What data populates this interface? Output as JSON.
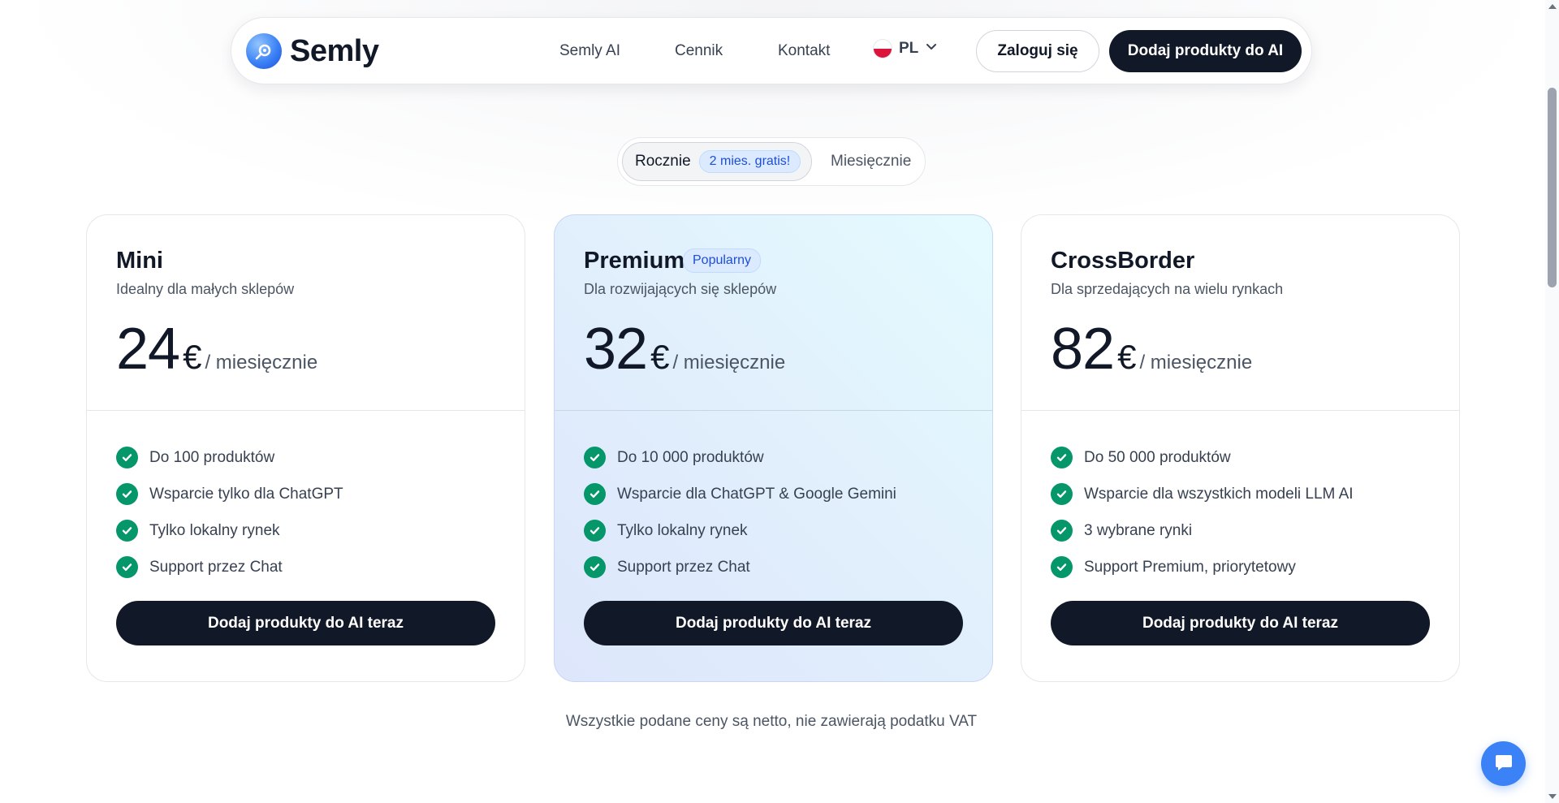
{
  "nav": {
    "brand": "Semly",
    "links": [
      "Semly AI",
      "Cennik",
      "Kontakt"
    ],
    "language": "PL",
    "login_label": "Zaloguj się",
    "cta_label": "Dodaj produkty do AI"
  },
  "billing": {
    "annual_label": "Rocznie",
    "annual_badge": "2 mies. gratis!",
    "monthly_label": "Miesięcznie",
    "selected": "annual"
  },
  "plans": [
    {
      "name": "Mini",
      "description": "Idealny dla małych sklepów",
      "price": "24",
      "currency": "€",
      "period": "/ miesięcznie",
      "features": [
        "Do 100 produktów",
        "Wsparcie tylko dla ChatGPT",
        "Tylko lokalny rynek",
        "Support przez Chat"
      ],
      "cta": "Dodaj produkty do AI teraz"
    },
    {
      "name": "Premium",
      "badge": "Popularny",
      "description": "Dla rozwijających się sklepów",
      "price": "32",
      "currency": "€",
      "period": "/ miesięcznie",
      "features": [
        "Do 10 000 produktów",
        "Wsparcie dla ChatGPT & Google Gemini",
        "Tylko lokalny rynek",
        "Support przez Chat"
      ],
      "cta": "Dodaj produkty do AI teraz"
    },
    {
      "name": "CrossBorder",
      "description": "Dla sprzedających na wielu rynkach",
      "price": "82",
      "currency": "€",
      "period": "/ miesięcznie",
      "features": [
        "Do 50 000 produktów",
        "Wsparcie dla wszystkich modeli LLM AI",
        "3 wybrane rynki",
        "Support Premium, priorytetowy"
      ],
      "cta": "Dodaj produkty do AI teraz"
    }
  ],
  "footer_note": "Wszystkie podane ceny są netto, nie zawierają podatku VAT",
  "icons": {
    "logo": "semly-logo-icon",
    "feature_check": "check-icon",
    "language_chevron": "chevron-down-icon",
    "chat": "chat-icon"
  },
  "colors": {
    "primary_dark": "#111827",
    "accent_blue": "#3b82f6",
    "badge_bg": "#dbeafe",
    "badge_text": "#1d4ed8",
    "check_green": "#059669"
  }
}
